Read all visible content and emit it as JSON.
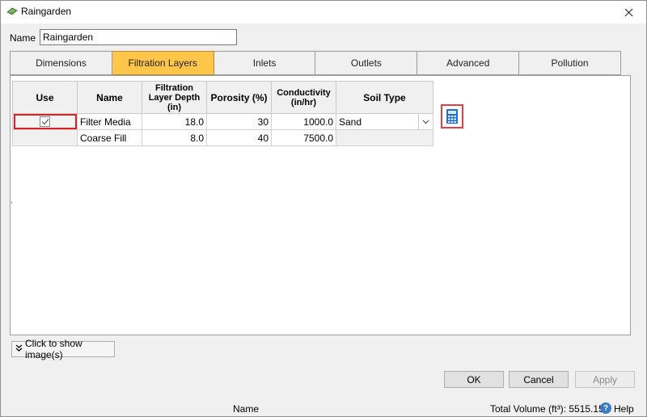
{
  "window": {
    "title": "Raingarden",
    "close_glyph": "✕"
  },
  "name_field": {
    "label": "Name",
    "value": "Raingarden"
  },
  "tabs": [
    {
      "label": "Dimensions",
      "active": false
    },
    {
      "label": "Filtration Layers",
      "active": true
    },
    {
      "label": "Inlets",
      "active": false
    },
    {
      "label": "Outlets",
      "active": false
    },
    {
      "label": "Advanced",
      "active": false
    },
    {
      "label": "Pollution",
      "active": false
    }
  ],
  "grid": {
    "headers": {
      "use": "Use",
      "name": "Name",
      "depth": "Filtration Layer Depth (in)",
      "porosity": "Porosity (%)",
      "conductivity": "Conductivity (in/hr)",
      "soil": "Soil Type"
    },
    "rows": [
      {
        "use_checked": true,
        "name": "Filter Media",
        "depth": "18.0",
        "porosity": "30",
        "conductivity": "1000.0",
        "soil": "Sand"
      },
      {
        "name": "Coarse Fill",
        "depth": "8.0",
        "porosity": "40",
        "conductivity": "7500.0",
        "soil": ""
      }
    ]
  },
  "show_images_button": {
    "label": "Click to show image(s)",
    "icon": "double-chevron-down-icon"
  },
  "buttons": {
    "ok": "OK",
    "cancel": "Cancel",
    "apply": "Apply"
  },
  "status": {
    "name": "Name",
    "total_volume": "Total Volume (ft³): 5515.158",
    "help": "Help",
    "help_glyph": "?"
  },
  "colors": {
    "active_tab": "#ffc64a",
    "highlight_border": "#e02020",
    "calculator_icon": "#1f6fd1"
  }
}
